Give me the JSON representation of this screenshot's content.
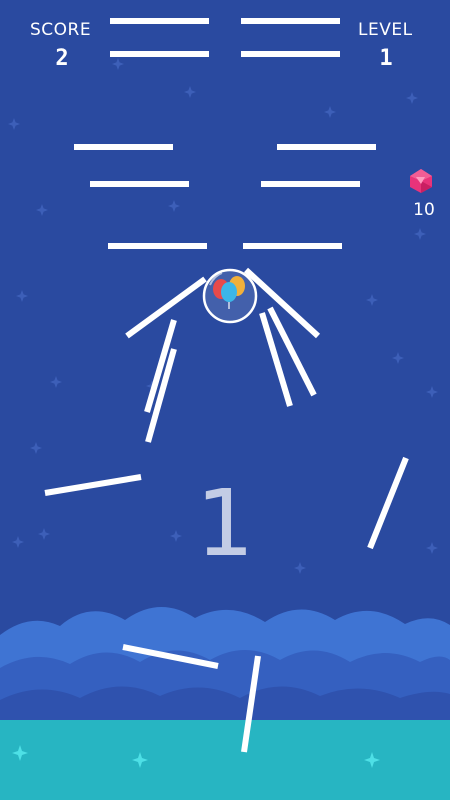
{
  "hud": {
    "score_label": "SCORE",
    "score_value": "2",
    "level_label": "LEVEL",
    "level_value": "1"
  },
  "gems": {
    "count": "10",
    "icon": "pink-gem-icon"
  },
  "countdown": "1",
  "colors": {
    "sky": "#2a4aa0",
    "cloud_light": "#3f74d3",
    "cloud_mid": "#3560c0",
    "cloud_dark": "#2f52ae",
    "ground": "#27b5c2",
    "bar": "#ffffff",
    "gem": "#e8337a",
    "star": "#3d5fb8"
  },
  "player": {
    "name": "balloon-bubble",
    "balloon_colors": [
      "#e84a4a",
      "#f2b03a",
      "#3cb6e8"
    ]
  }
}
